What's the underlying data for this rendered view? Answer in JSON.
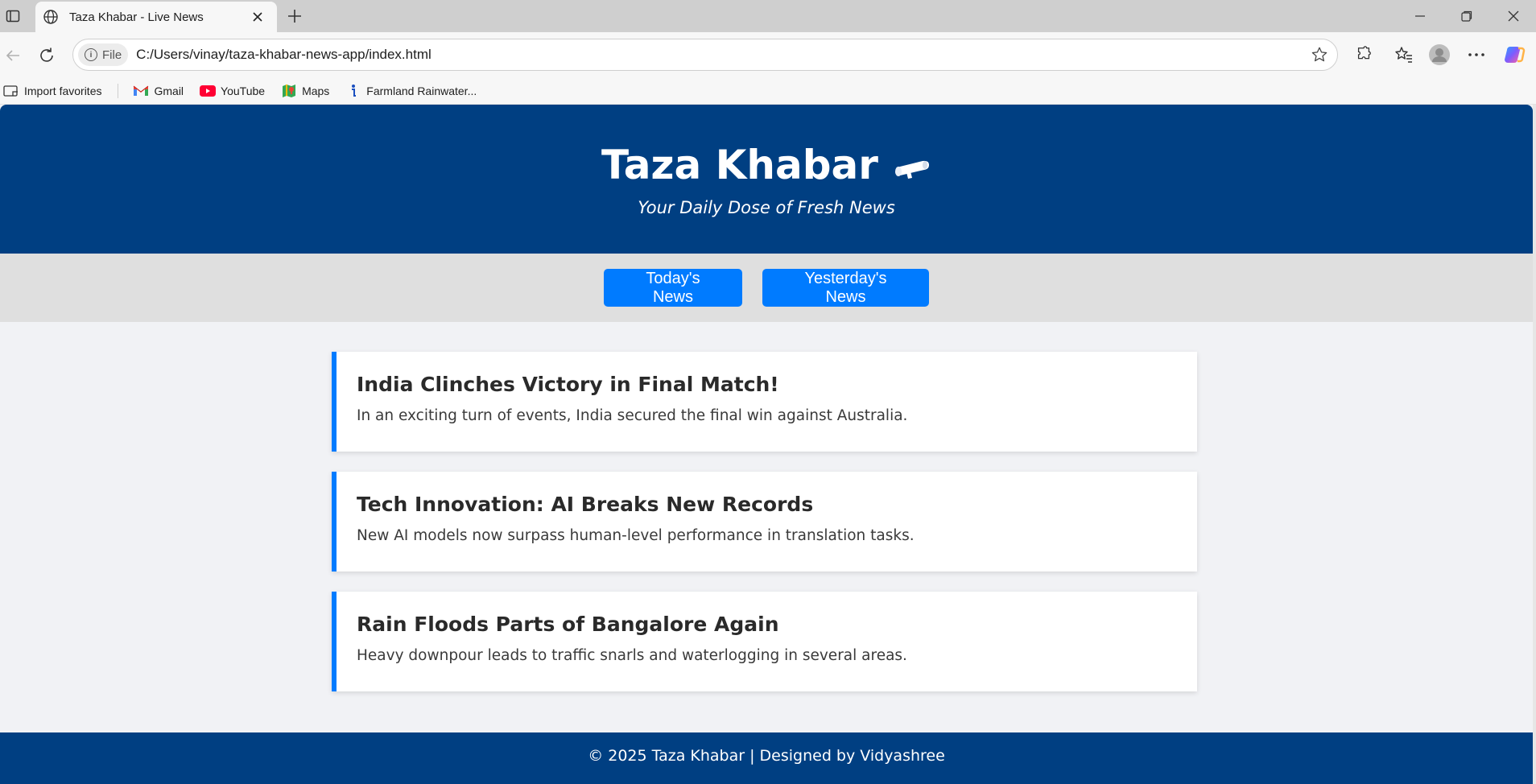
{
  "browser": {
    "tab": {
      "title": "Taza Khabar - Live News",
      "icon": "globe-icon"
    },
    "new_tab_label": "+",
    "address": {
      "scheme_label": "File",
      "url": "C:/Users/vinay/taza-khabar-news-app/index.html"
    },
    "favorites": [
      {
        "label": "Import favorites",
        "icon": "import-icon"
      },
      {
        "label": "Gmail",
        "icon": "gmail-icon"
      },
      {
        "label": "YouTube",
        "icon": "youtube-icon"
      },
      {
        "label": "Maps",
        "icon": "maps-icon"
      },
      {
        "label": "Farmland Rainwater...",
        "icon": "info-site-icon"
      }
    ]
  },
  "site": {
    "title": "Taza Khabar",
    "title_icon": "megaphone-icon",
    "tagline": "Your Daily Dose of Fresh News",
    "nav": {
      "today_label": "Today's News",
      "yesterday_label": "Yesterday's News"
    },
    "articles": [
      {
        "headline": "India Clinches Victory in Final Match!",
        "summary": "In an exciting turn of events, India secured the final win against Australia."
      },
      {
        "headline": "Tech Innovation: AI Breaks New Records",
        "summary": "New AI models now surpass human-level performance in translation tasks."
      },
      {
        "headline": "Rain Floods Parts of Bangalore Again",
        "summary": "Heavy downpour leads to traffic snarls and waterlogging in several areas."
      }
    ],
    "footer": "© 2025 Taza Khabar | Designed by Vidyashree"
  },
  "colors": {
    "header_bg": "#003f82",
    "accent": "#007bff",
    "nav_bg": "#dfdfdf",
    "page_bg": "#f1f2f5"
  }
}
